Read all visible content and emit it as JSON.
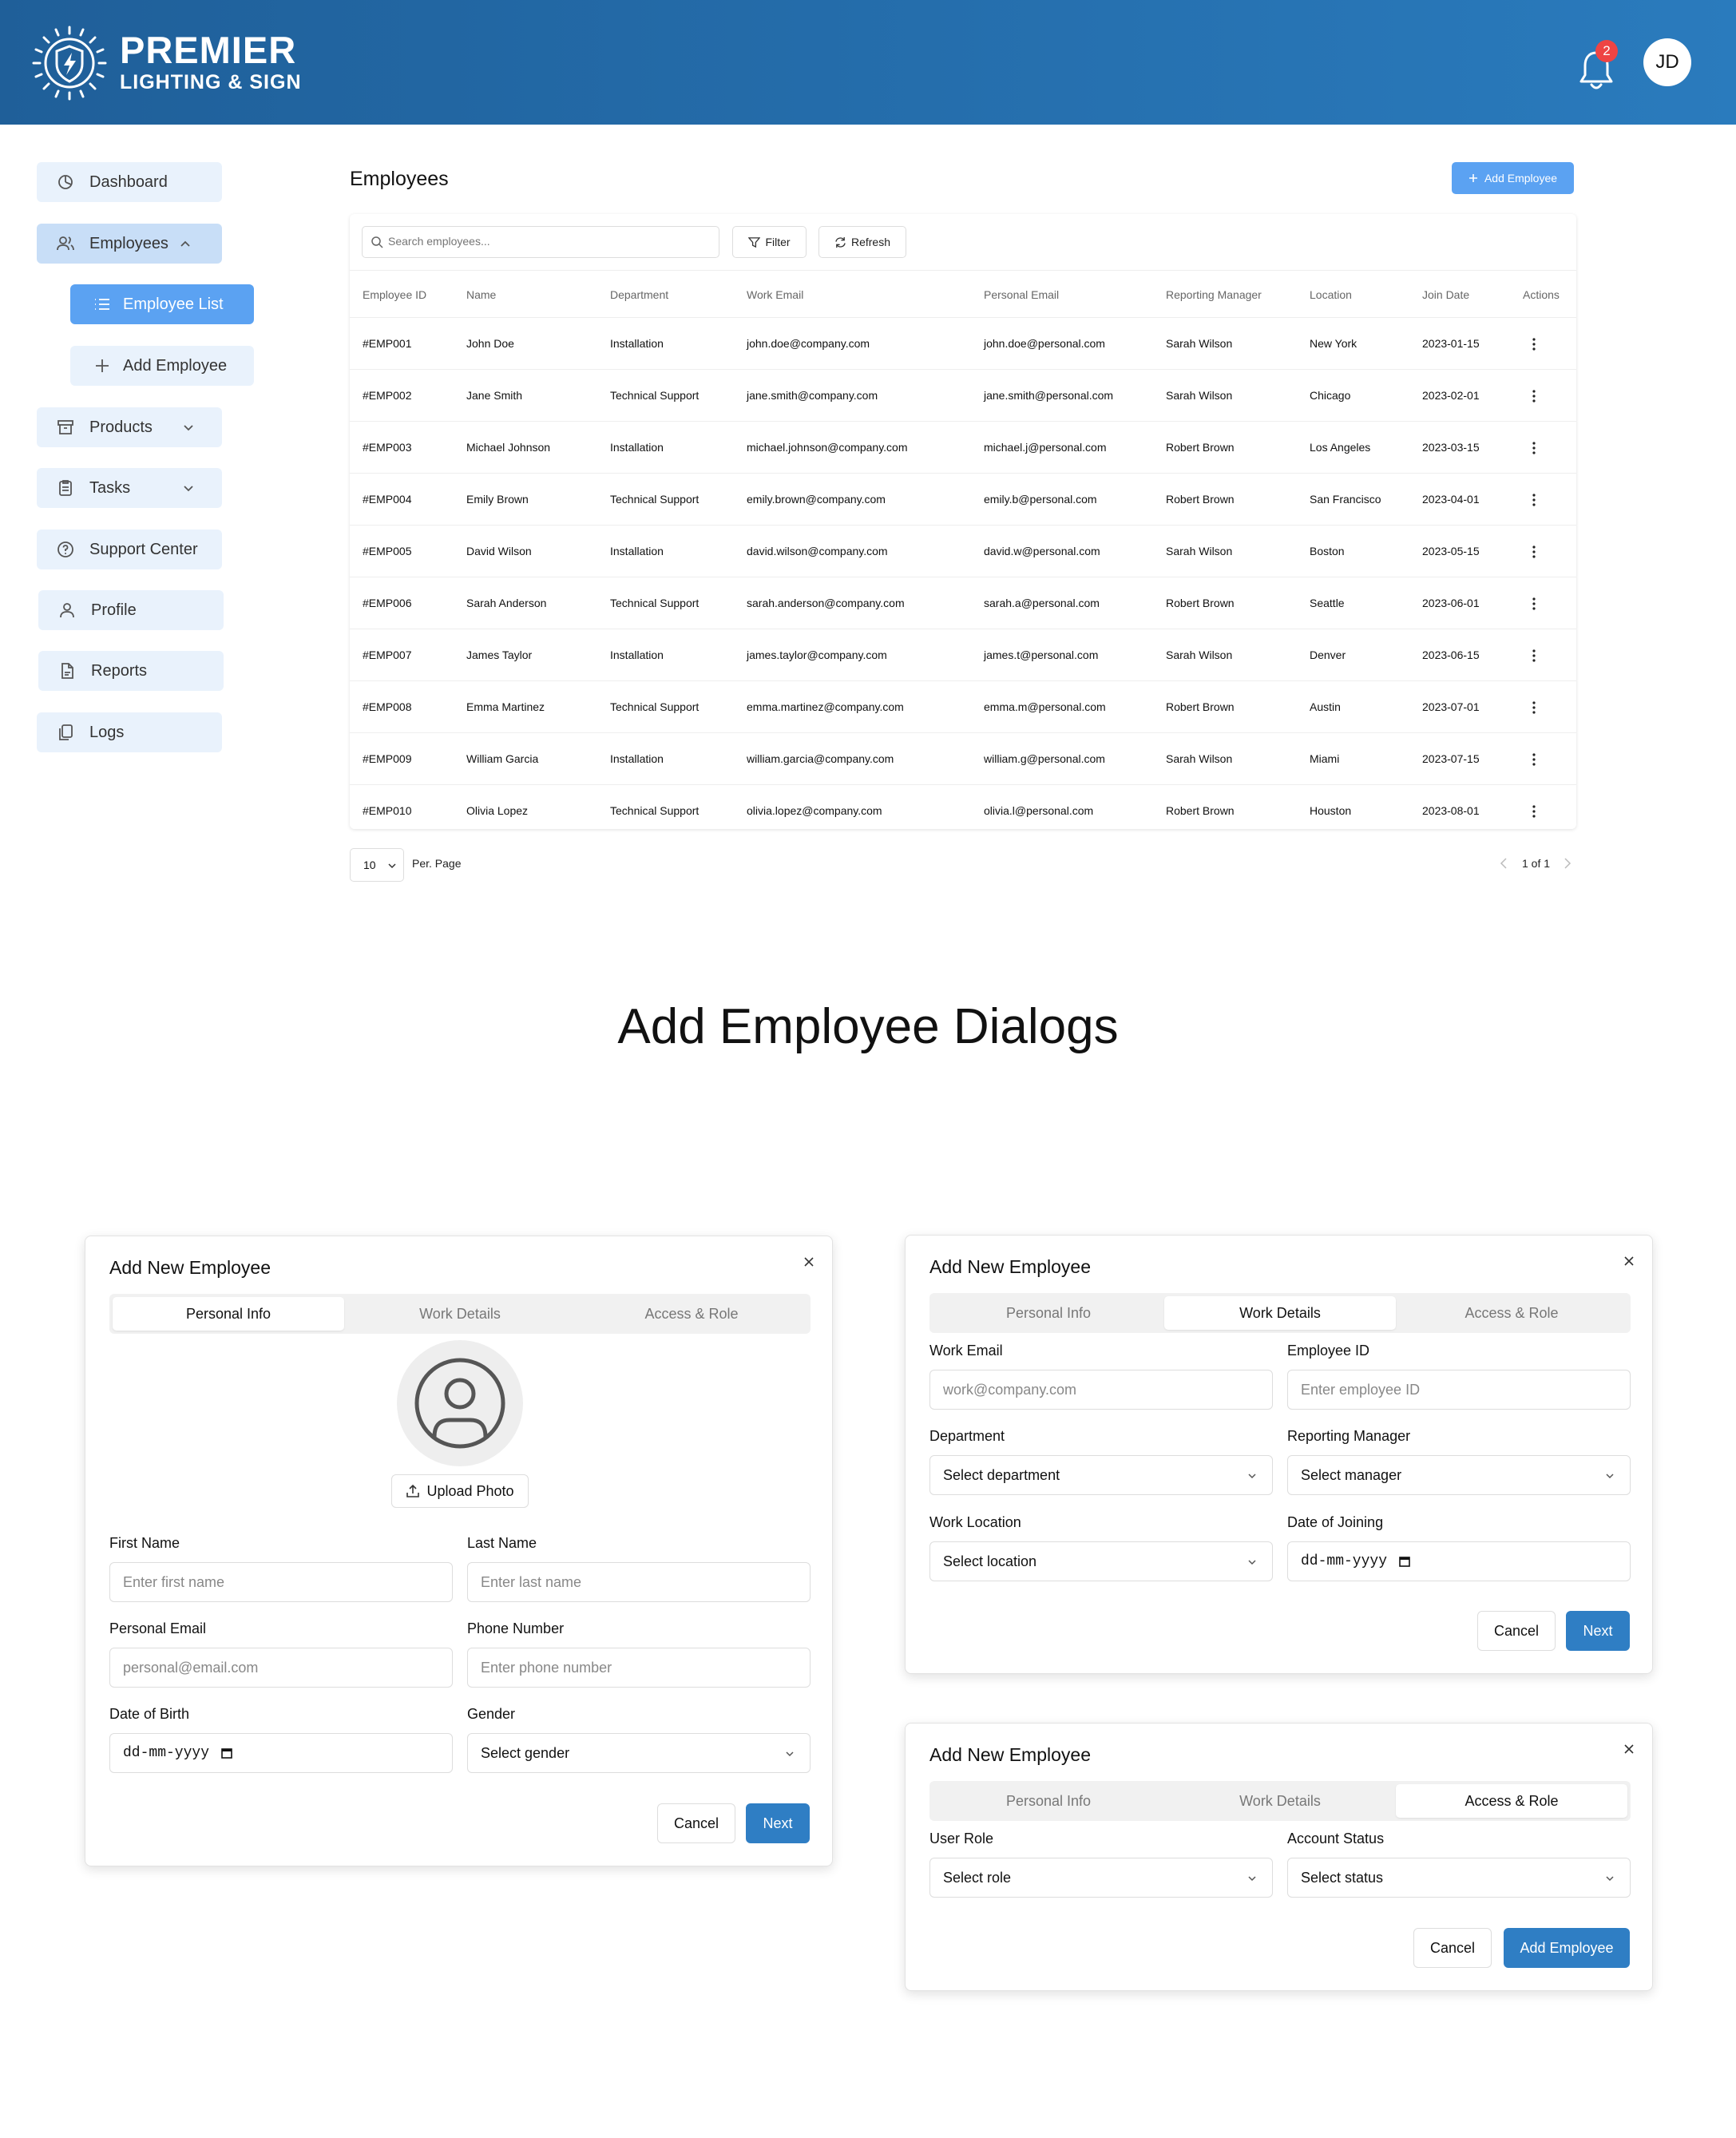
{
  "header": {
    "brand_line1": "PREMIER",
    "brand_line2": "LIGHTING & SIGN",
    "notification_count": "2",
    "avatar_initials": "JD"
  },
  "sidebar": {
    "items": [
      {
        "label": "Dashboard",
        "icon": "dashboard-icon"
      },
      {
        "label": "Employees",
        "icon": "users-icon"
      },
      {
        "label": "Employee List",
        "icon": "list-icon"
      },
      {
        "label": "Add Employee",
        "icon": "plus-icon"
      },
      {
        "label": "Products",
        "icon": "archive-icon"
      },
      {
        "label": "Tasks",
        "icon": "clipboard-icon"
      },
      {
        "label": "Support Center",
        "icon": "help-icon"
      },
      {
        "label": "Profile",
        "icon": "user-icon"
      },
      {
        "label": "Reports",
        "icon": "file-icon"
      },
      {
        "label": "Logs",
        "icon": "copy-icon"
      }
    ]
  },
  "main": {
    "title": "Employees",
    "add_button": "Add Employee",
    "search_placeholder": "Search employees...",
    "filter_label": "Filter",
    "refresh_label": "Refresh",
    "columns": [
      "Employee ID",
      "Name",
      "Department",
      "Work Email",
      "Personal Email",
      "Reporting Manager",
      "Location",
      "Join Date",
      "Actions"
    ],
    "rows": [
      [
        "#EMP001",
        "John Doe",
        "Installation",
        "john.doe@company.com",
        "john.doe@personal.com",
        "Sarah Wilson",
        "New York",
        "2023-01-15"
      ],
      [
        "#EMP002",
        "Jane Smith",
        "Technical Support",
        "jane.smith@company.com",
        "jane.smith@personal.com",
        "Sarah Wilson",
        "Chicago",
        "2023-02-01"
      ],
      [
        "#EMP003",
        "Michael Johnson",
        "Installation",
        "michael.johnson@company.com",
        "michael.j@personal.com",
        "Robert Brown",
        "Los Angeles",
        "2023-03-15"
      ],
      [
        "#EMP004",
        "Emily Brown",
        "Technical Support",
        "emily.brown@company.com",
        "emily.b@personal.com",
        "Robert Brown",
        "San Francisco",
        "2023-04-01"
      ],
      [
        "#EMP005",
        "David Wilson",
        "Installation",
        "david.wilson@company.com",
        "david.w@personal.com",
        "Sarah Wilson",
        "Boston",
        "2023-05-15"
      ],
      [
        "#EMP006",
        "Sarah Anderson",
        "Technical Support",
        "sarah.anderson@company.com",
        "sarah.a@personal.com",
        "Robert Brown",
        "Seattle",
        "2023-06-01"
      ],
      [
        "#EMP007",
        "James Taylor",
        "Installation",
        "james.taylor@company.com",
        "james.t@personal.com",
        "Sarah Wilson",
        "Denver",
        "2023-06-15"
      ],
      [
        "#EMP008",
        "Emma Martinez",
        "Technical Support",
        "emma.martinez@company.com",
        "emma.m@personal.com",
        "Robert Brown",
        "Austin",
        "2023-07-01"
      ],
      [
        "#EMP009",
        "William Garcia",
        "Installation",
        "william.garcia@company.com",
        "william.g@personal.com",
        "Sarah Wilson",
        "Miami",
        "2023-07-15"
      ],
      [
        "#EMP010",
        "Olivia Lopez",
        "Technical Support",
        "olivia.lopez@company.com",
        "olivia.l@personal.com",
        "Robert Brown",
        "Houston",
        "2023-08-01"
      ]
    ],
    "per_page_value": "10",
    "per_page_label": "Per. Page",
    "page_info": "1 of 1"
  },
  "section_title": "Add Employee Dialogs",
  "dialog": {
    "title": "Add New Employee",
    "tabs": [
      "Personal Info",
      "Work Details",
      "Access & Role"
    ],
    "cancel": "Cancel",
    "next": "Next",
    "submit": "Add Employee",
    "personal": {
      "upload_photo": "Upload Photo",
      "first_name_label": "First Name",
      "first_name_placeholder": "Enter first name",
      "last_name_label": "Last Name",
      "last_name_placeholder": "Enter last name",
      "personal_email_label": "Personal Email",
      "personal_email_placeholder": "personal@email.com",
      "phone_label": "Phone Number",
      "phone_placeholder": "Enter phone number",
      "dob_label": "Date of Birth",
      "dob_value": "dd-mm-yyyy",
      "gender_label": "Gender",
      "gender_value": "Select gender"
    },
    "work": {
      "work_email_label": "Work Email",
      "work_email_placeholder": "work@company.com",
      "emp_id_label": "Employee ID",
      "emp_id_placeholder": "Enter employee ID",
      "department_label": "Department",
      "department_value": "Select department",
      "manager_label": "Reporting Manager",
      "manager_value": "Select manager",
      "location_label": "Work Location",
      "location_value": "Select location",
      "join_label": "Date of Joining",
      "join_value": "dd-mm-yyyy"
    },
    "access": {
      "role_label": "User Role",
      "role_value": "Select role",
      "status_label": "Account Status",
      "status_value": "Select status"
    }
  },
  "colors": {
    "header_start": "#1f5f99",
    "header_end": "#2a7bbd",
    "accent": "#5ba2f2",
    "primary_button": "#2f7ec4",
    "badge": "#ee4444"
  }
}
